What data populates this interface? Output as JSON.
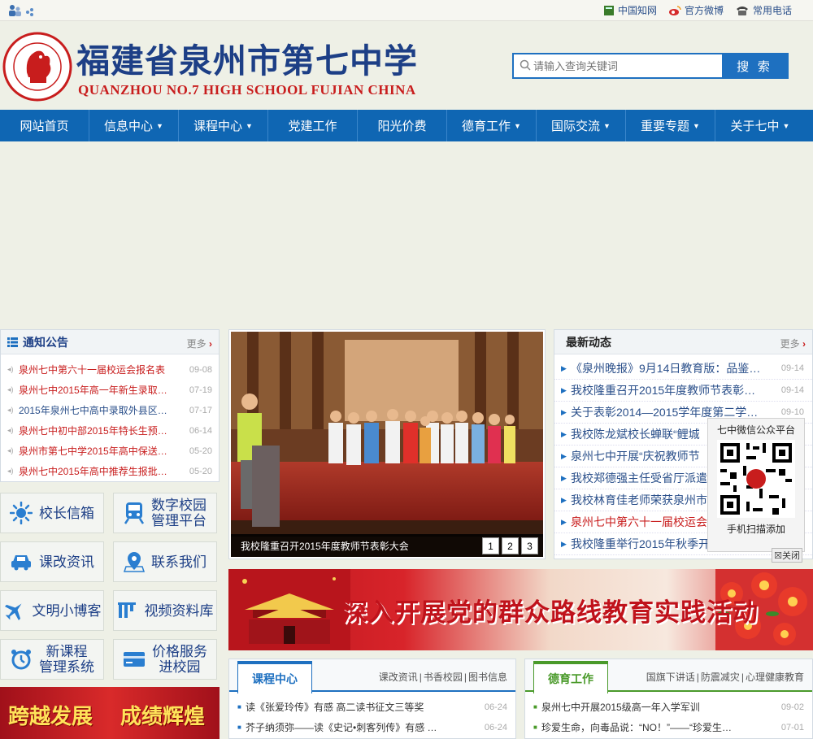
{
  "topbar": {
    "links": [
      {
        "icon": "book-icon",
        "label": "中国知网"
      },
      {
        "icon": "weibo-icon",
        "label": "官方微博"
      },
      {
        "icon": "phone-icon",
        "label": "常用电话"
      }
    ]
  },
  "header": {
    "school_cn": "福建省泉州市第七中学",
    "school_en": "QUANZHOU NO.7 HIGH SCHOOL FUJIAN CHINA",
    "search_placeholder": "请输入查询关键词",
    "search_button": "搜 索"
  },
  "nav": [
    {
      "label": "网站首页",
      "dropdown": false
    },
    {
      "label": "信息中心",
      "dropdown": true
    },
    {
      "label": "课程中心",
      "dropdown": true
    },
    {
      "label": "党建工作",
      "dropdown": false
    },
    {
      "label": "阳光价费",
      "dropdown": false
    },
    {
      "label": "德育工作",
      "dropdown": true
    },
    {
      "label": "国际交流",
      "dropdown": true
    },
    {
      "label": "重要专题",
      "dropdown": true
    },
    {
      "label": "关于七中",
      "dropdown": true
    }
  ],
  "notice": {
    "title": "通知公告",
    "more": "更多",
    "items": [
      {
        "text": "泉州七中第六十一届校运会报名表",
        "date": "09-08",
        "color": "red"
      },
      {
        "text": "泉州七中2015年高一年新生录取…",
        "date": "07-19",
        "color": "red"
      },
      {
        "text": "2015年泉州七中高中录取外县区…",
        "date": "07-17",
        "color": "blue"
      },
      {
        "text": "泉州七中初中部2015年特长生预…",
        "date": "06-14",
        "color": "red"
      },
      {
        "text": "泉州市第七中学2015年高中保送…",
        "date": "05-20",
        "color": "red"
      },
      {
        "text": "泉州七中2015年高中推荐生报批…",
        "date": "05-20",
        "color": "red"
      }
    ]
  },
  "quick": [
    {
      "icon": "sun-icon",
      "label": "校长信箱"
    },
    {
      "icon": "train-icon",
      "label": "数字校园\n管理平台"
    },
    {
      "icon": "car-icon",
      "label": "课改资讯"
    },
    {
      "icon": "location-icon",
      "label": "联系我们"
    },
    {
      "icon": "airplane-icon",
      "label": "文明小博客"
    },
    {
      "icon": "video-icon",
      "label": "视频资料库"
    },
    {
      "icon": "alarm-icon",
      "label": "新课程\n管理系统"
    },
    {
      "icon": "card-icon",
      "label": "价格服务\n进校园"
    }
  ],
  "left_banner": {
    "text1": "跨越发展",
    "text2": "成绩辉煌"
  },
  "slider": {
    "caption": "我校隆重召开2015年度教师节表彰大会",
    "pages": [
      "1",
      "2",
      "3"
    ]
  },
  "news": {
    "title": "最新动态",
    "more": "更多",
    "items": [
      {
        "text": "《泉州晚报》9月14日教育版：品鉴…",
        "date": "09-14",
        "color": "blue"
      },
      {
        "text": "我校隆重召开2015年度教师节表彰大会",
        "date": "09-14",
        "color": "blue"
      },
      {
        "text": "关于表彰2014—2015学年度第二学期…",
        "date": "09-10",
        "color": "blue"
      },
      {
        "text": "我校陈龙斌校长蝉联“鲤城",
        "date": "",
        "color": "blue"
      },
      {
        "text": "泉州七中开展“庆祝教师节",
        "date": "",
        "color": "blue"
      },
      {
        "text": "我校郑德强主任受省厅派遣",
        "date": "",
        "color": "blue"
      },
      {
        "text": "我校林育佳老师荣获泉州市",
        "date": "",
        "color": "blue"
      },
      {
        "text": "泉州七中第六十一届校运会",
        "date": "",
        "color": "red"
      },
      {
        "text": "我校隆重举行2015年秋季开学式暨助…",
        "date": "",
        "color": "blue"
      }
    ]
  },
  "qr": {
    "title": "七中微信公众平台",
    "subtitle": "手机扫描添加",
    "close": "关闭"
  },
  "party_banner": {
    "slogan": "深入开展党的群众路线教育实践活动"
  },
  "course": {
    "tab": "课程中心",
    "links": [
      "课改资讯",
      "书香校园",
      "图书信息"
    ],
    "items": [
      {
        "text": "读《张爱玲传》有感 高二读书征文三等奖",
        "date": "06-24"
      },
      {
        "text": "芥子纳须弥——读《史记•刺客列传》有感 …",
        "date": "06-24"
      }
    ]
  },
  "moral": {
    "tab": "德育工作",
    "links": [
      "国旗下讲话",
      "防震减灾",
      "心理健康教育"
    ],
    "items": [
      {
        "text": "泉州七中开展2015级高一年入学军训",
        "date": "09-02"
      },
      {
        "text": "珍爱生命，向毒品说：“NO！”——“珍爱生命…",
        "date": "07-01"
      }
    ]
  },
  "colors": {
    "nav": "#0f66b3",
    "brand_blue": "#1d3f86",
    "brand_red": "#c81d1d",
    "green": "#4a9a2a"
  }
}
